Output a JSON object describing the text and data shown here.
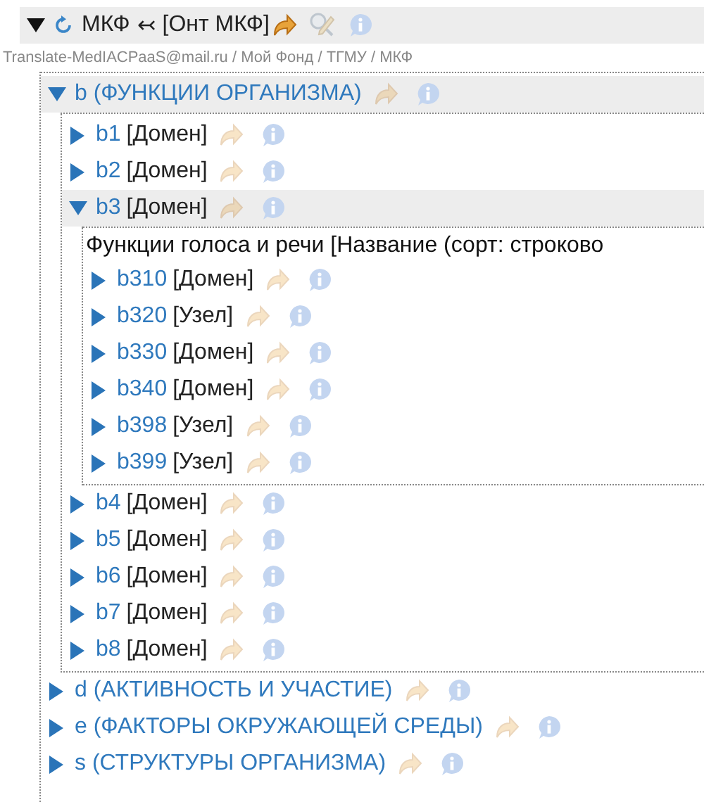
{
  "root": {
    "title": "МКФ",
    "relation": "↢",
    "ontology": "[Онт МКФ]",
    "expanded": true,
    "active": true,
    "breadcrumb": "Translate-MedIACPaaS@mail.ru / Мой Фонд / ТГМУ  / МКФ",
    "children": [
      {
        "name": "b (ФУНКЦИИ ОРГАНИЗМА)",
        "expanded": true,
        "children": [
          {
            "name": "b1",
            "type": "[Домен]",
            "expanded": false
          },
          {
            "name": "b2",
            "type": "[Домен]",
            "expanded": false
          },
          {
            "name": "b3",
            "type": "[Домен]",
            "expanded": true,
            "description": "Функции голоса и речи [Название (сорт: строково",
            "children": [
              {
                "name": "b310",
                "type": "[Домен]",
                "expanded": false
              },
              {
                "name": "b320",
                "type": "[Узел]",
                "expanded": false
              },
              {
                "name": "b330",
                "type": "[Домен]",
                "expanded": false
              },
              {
                "name": "b340",
                "type": "[Домен]",
                "expanded": false
              },
              {
                "name": "b398",
                "type": "[Узел]",
                "expanded": false
              },
              {
                "name": "b399",
                "type": "[Узел]",
                "expanded": false
              }
            ]
          },
          {
            "name": "b4",
            "type": "[Домен]",
            "expanded": false
          },
          {
            "name": "b5",
            "type": "[Домен]",
            "expanded": false
          },
          {
            "name": "b6",
            "type": "[Домен]",
            "expanded": false
          },
          {
            "name": "b7",
            "type": "[Домен]",
            "expanded": false
          },
          {
            "name": "b8",
            "type": "[Домен]",
            "expanded": false
          }
        ]
      },
      {
        "name": "d (АКТИВНОСТЬ И УЧАСТИЕ)",
        "expanded": false
      },
      {
        "name": "e (ФАКТОРЫ ОКРУЖАЮЩЕЙ СРЕДЫ)",
        "expanded": false
      },
      {
        "name": "s (СТРУКТУРЫ ОРГАНИЗМА)",
        "expanded": false
      }
    ]
  }
}
